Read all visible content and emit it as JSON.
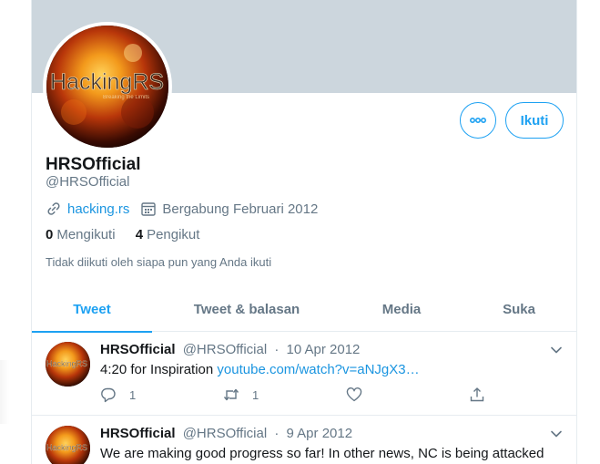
{
  "profile": {
    "display_name": "HRSOfficial",
    "handle": "@HRSOfficial",
    "website": "hacking.rs",
    "joined": "Bergabung Februari 2012",
    "following_count": "0",
    "following_label": "Mengikuti",
    "followers_count": "4",
    "followers_label": "Pengikut",
    "not_followed_text": "Tidak diikuti oleh siapa pun yang Anda ikuti",
    "avatar_logo_text": "HackingRS",
    "avatar_logo_subtext": "Breaking the Limits"
  },
  "buttons": {
    "follow_label": "Ikuti",
    "more_icon": "more-options-icon"
  },
  "tabs": [
    {
      "label": "Tweet",
      "active": true
    },
    {
      "label": "Tweet & balasan",
      "active": false
    },
    {
      "label": "Media",
      "active": false
    },
    {
      "label": "Suka",
      "active": false
    }
  ],
  "tweets": [
    {
      "name": "HRSOfficial",
      "handle": "@HRSOfficial",
      "separator": "·",
      "date": "10 Apr 2012",
      "text": "4:20 for Inspiration ",
      "link": "youtube.com/watch?v=aNJgX3…",
      "reply_count": "1",
      "retweet_count": "1"
    },
    {
      "name": "HRSOfficial",
      "handle": "@HRSOfficial",
      "separator": "·",
      "date": "9 Apr 2012",
      "text": "We are making good progress so far! In other news, NC is being attacked"
    }
  ],
  "colors": {
    "accent": "#1da1f2",
    "link": "#1b95e0",
    "banner": "#ccd6dd",
    "secondary_text": "#657786"
  }
}
